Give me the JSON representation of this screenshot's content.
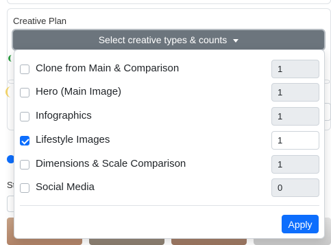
{
  "creative_plan": {
    "title": "Creative Plan",
    "select_button_label": "Select creative types & counts",
    "background_label_fragment": "St"
  },
  "dropdown": {
    "items": [
      {
        "label": "Clone from Main & Comparison",
        "checked": false,
        "count": "1"
      },
      {
        "label": "Hero (Main Image)",
        "checked": false,
        "count": "1"
      },
      {
        "label": "Infographics",
        "checked": false,
        "count": "1"
      },
      {
        "label": "Lifestyle Images",
        "checked": true,
        "count": "1"
      },
      {
        "label": "Dimensions & Scale Comparison",
        "checked": false,
        "count": "1"
      },
      {
        "label": "Social Media",
        "checked": false,
        "count": "0"
      }
    ],
    "apply_label": "Apply"
  },
  "colors": {
    "primary": "#0d6efd",
    "secondary": "#6c757d"
  }
}
